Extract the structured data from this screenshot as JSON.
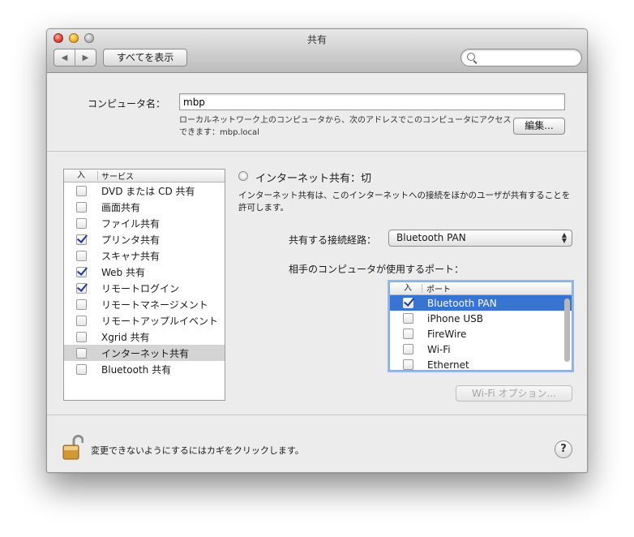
{
  "window": {
    "title": "共有"
  },
  "toolbar": {
    "back_glyph": "◀",
    "forward_glyph": "▶",
    "show_all_label": "すべてを表示",
    "search_placeholder": ""
  },
  "computer": {
    "label": "コンピュータ名：",
    "name": "mbp",
    "description": "ローカルネットワーク上のコンピュータから、次のアドレスでこのコンピュータにアクセスできます：mbp.local",
    "edit_label": "編集..."
  },
  "services": {
    "header_on": "入",
    "header_service": "サービス",
    "items": [
      {
        "label": "DVD または CD 共有",
        "checked": false
      },
      {
        "label": "画面共有",
        "checked": false
      },
      {
        "label": "ファイル共有",
        "checked": false
      },
      {
        "label": "プリンタ共有",
        "checked": true
      },
      {
        "label": "スキャナ共有",
        "checked": false
      },
      {
        "label": "Web 共有",
        "checked": true
      },
      {
        "label": "リモートログイン",
        "checked": true
      },
      {
        "label": "リモートマネージメント",
        "checked": false
      },
      {
        "label": "リモートアップルイベント",
        "checked": false
      },
      {
        "label": "Xgrid 共有",
        "checked": false
      },
      {
        "label": "インターネット共有",
        "checked": false,
        "selected": true
      },
      {
        "label": "Bluetooth 共有",
        "checked": false
      }
    ]
  },
  "detail": {
    "status_title": "インターネット共有：切",
    "description": "インターネット共有は、このインターネットへの接続をほかのユーザが共有することを許可します。",
    "share_from_label": "共有する接続経路：",
    "share_from_value": "Bluetooth PAN",
    "ports_label": "相手のコンピュータが使用するポート：",
    "ports_header_on": "入",
    "ports_header_port": "ポート",
    "ports": [
      {
        "label": "Bluetooth PAN",
        "checked": true,
        "selected": true
      },
      {
        "label": "iPhone USB",
        "checked": false
      },
      {
        "label": "FireWire",
        "checked": false
      },
      {
        "label": "Wi-Fi",
        "checked": false
      },
      {
        "label": "Ethernet",
        "checked": false
      }
    ],
    "wifi_options_label": "Wi-Fi オプション..."
  },
  "footer": {
    "lock_text": "変更できないようにするにはカギをクリックします。",
    "help_label": "?"
  },
  "colors": {
    "selection_blue": "#3874d1",
    "check_navy": "#1f3a8a",
    "focus_ring": "#93b9ea"
  }
}
